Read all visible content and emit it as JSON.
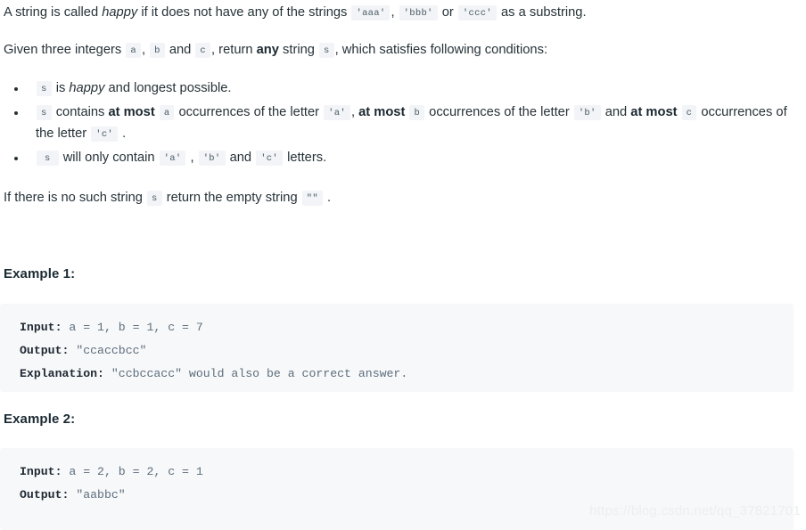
{
  "problem": {
    "intro": {
      "before": "A string is called ",
      "happy_word": "happy",
      "middle": " if it does not have any of the strings ",
      "code_aaa": "'aaa'",
      "sep1": ", ",
      "code_bbb": "'bbb'",
      "sep2": " or ",
      "code_ccc": "'ccc'",
      "after": " as a substring."
    },
    "given": {
      "before": "Given three integers ",
      "code_a": "a",
      "sep1": ", ",
      "code_b": "b",
      "sep2": " and ",
      "code_c": "c",
      "mid": ", return ",
      "any_word": "any",
      "mid2": " string ",
      "code_s": "s",
      "after": ", which satisfies following conditions:"
    },
    "bullets": [
      {
        "code_s": "s",
        "t1": " is ",
        "happy_word": "happy",
        "t2": " and longest possible."
      },
      {
        "code_s": "s",
        "t1": " contains ",
        "b1": "at most",
        "t2": " ",
        "code_a": "a",
        "t3": " occurrences of the letter ",
        "code_qa": "'a'",
        "t4": ", ",
        "b2": "at most",
        "t5": " ",
        "code_b": "b",
        "t6": " occurrences of the letter ",
        "code_qb": "'b'",
        "t7": " and ",
        "b3": "at most",
        "t8": " ",
        "code_c": "c",
        "t9": " occurrences of the letter ",
        "code_qc": "'c'",
        "t10": " ."
      },
      {
        "code_s": "s",
        "t1": " will only contain ",
        "code_qa": "'a'",
        "t2": " , ",
        "code_qb": "'b'",
        "t3": " and ",
        "code_qc": "'c'",
        "t4": " letters."
      }
    ],
    "no_string": {
      "before": "If there is no such string ",
      "code_s": "s",
      "middle": " return the empty string ",
      "code_empty": "\"\"",
      "after": " ."
    }
  },
  "examples": [
    {
      "heading": "Example 1:",
      "lines": [
        {
          "label": "Input:",
          "value": " a = 1, b = 1, c = 7"
        },
        {
          "label": "Output:",
          "value": " \"ccaccbcc\""
        },
        {
          "label": "Explanation:",
          "value": " \"ccbccacc\" would also be a correct answer."
        }
      ]
    },
    {
      "heading": "Example 2:",
      "lines": [
        {
          "label": "Input:",
          "value": " a = 2, b = 2, c = 1"
        },
        {
          "label": "Output:",
          "value": " \"aabbc\""
        }
      ]
    }
  ],
  "watermark": {
    "text": "https://blog.csdn.net/qq_37821701"
  },
  "colors": {
    "body_text": "#263238",
    "inline_code_bg": "#f2f4f7",
    "inline_code_text": "#4a5b66",
    "code_block_bg": "#f7f8fa",
    "code_label": "#202a33",
    "code_value": "#5d6e7b",
    "watermark": "#eceef0",
    "page_bg": "#ffffff"
  }
}
